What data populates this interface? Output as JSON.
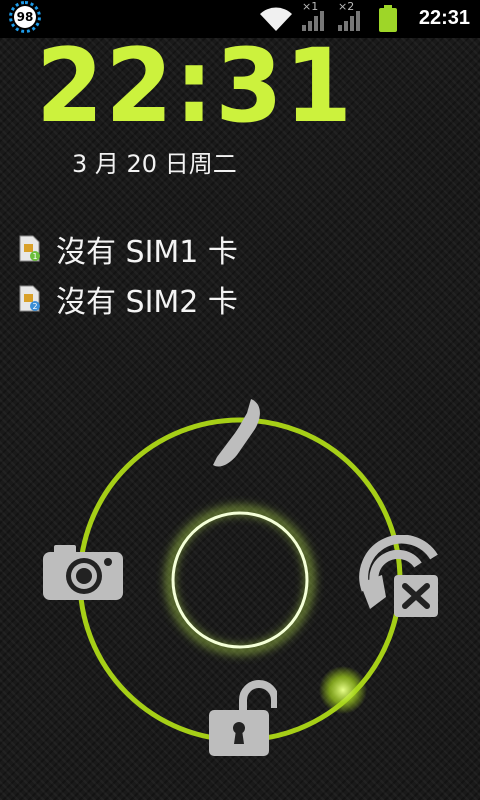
{
  "status_bar": {
    "battery_badge": "98",
    "sim1_marker": "×1",
    "sim2_marker": "×2",
    "time": "22:31",
    "icons": [
      "wifi-icon",
      "signal-sim1-icon",
      "signal-sim2-icon",
      "battery-icon"
    ],
    "battery_color": "#9ed628"
  },
  "lockscreen": {
    "clock": "22:31",
    "date": "3 月 20 日周二",
    "clock_color": "#ccf23d",
    "ring_color": "#a6cf17",
    "sim_status": [
      {
        "label": "沒有 SIM1 卡",
        "icon": "sim-card-1-icon"
      },
      {
        "label": "沒有 SIM2 卡",
        "icon": "sim-card-2-icon"
      }
    ],
    "targets": [
      "phone-icon",
      "camera-icon",
      "sound-off-icon",
      "unlock-icon"
    ]
  }
}
